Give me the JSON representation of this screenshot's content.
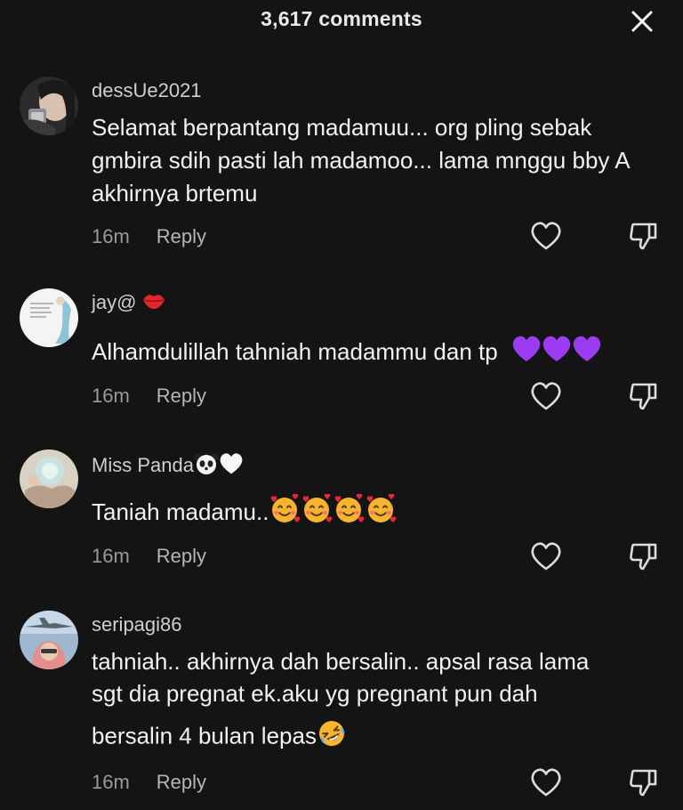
{
  "header": {
    "title": "3,617 comments",
    "close_icon": "close-icon"
  },
  "comments": [
    {
      "username": "dessUe2021",
      "text": "Selamat berpantang madamuu... org pling sebak gmbira sdih pasti lah madamoo... lama mnggu bby A akhirnya brtemu",
      "time": "16m",
      "reply": "Reply",
      "username_emoji": [],
      "text_emoji": []
    },
    {
      "username": "jay@",
      "text": "Alhamdulillah tahniah madammu dan tp",
      "time": "16m",
      "reply": "Reply",
      "username_emoji": [
        "lips-emoji"
      ],
      "text_emoji": [
        "purple-heart-emoji",
        "purple-heart-emoji",
        "purple-heart-emoji"
      ]
    },
    {
      "username": "Miss Panda",
      "text": "Taniah madamu..",
      "time": "16m",
      "reply": "Reply",
      "username_emoji": [
        "panda-emoji",
        "white-heart-emoji"
      ],
      "text_emoji": [
        "smiling-face-with-hearts-emoji",
        "smiling-face-with-hearts-emoji",
        "smiling-face-with-hearts-emoji",
        "smiling-face-with-hearts-emoji"
      ]
    },
    {
      "username": "seripagi86",
      "text_lines": [
        "tahniah.. akhirnya dah bersalin.. apsal rasa lama",
        "sgt dia pregnat ek.aku yg pregnant pun dah",
        "bersalin 4 bulan lepas"
      ],
      "time": "16m",
      "reply": "Reply",
      "username_emoji": [],
      "text_emoji": [
        "rolling-on-floor-laughing-emoji"
      ]
    }
  ],
  "colors": {
    "background": "#141414",
    "text": "#f2f2f2",
    "meta": "#9a9a9a",
    "purple_heart": "#9b3cf2",
    "emoji_yellow": "#f7b52b"
  },
  "icons": {
    "like": "heart-outline-icon",
    "dislike": "thumbs-down-outline-icon"
  }
}
